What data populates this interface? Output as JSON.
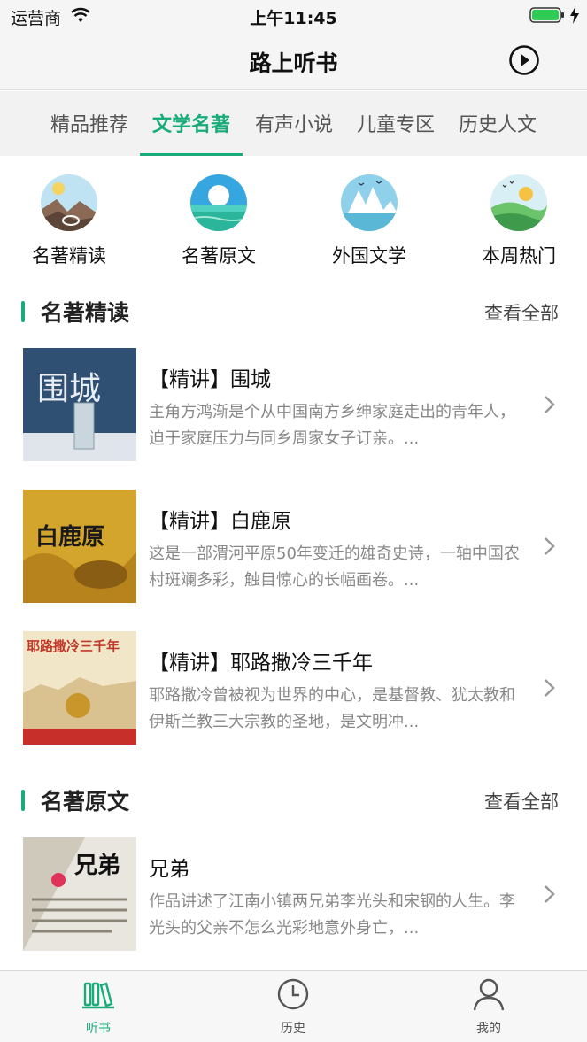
{
  "status_bar": {
    "carrier": "运营商",
    "time": "上午11:45"
  },
  "nav": {
    "title": "路上听书"
  },
  "tabs": [
    {
      "label": "精品推荐",
      "active": false
    },
    {
      "label": "文学名著",
      "active": true
    },
    {
      "label": "有声小说",
      "active": false
    },
    {
      "label": "儿童专区",
      "active": false
    },
    {
      "label": "历史人文",
      "active": false
    }
  ],
  "categories": [
    {
      "label": "名著精读"
    },
    {
      "label": "名著原文"
    },
    {
      "label": "外国文学"
    },
    {
      "label": "本周热门"
    }
  ],
  "sections": [
    {
      "title": "名著精读",
      "more": "查看全部",
      "books": [
        {
          "title": "【精讲】围城",
          "desc": "主角方鸿渐是个从中国南方乡绅家庭走出的青年人，迫于家庭压力与同乡周家女子订亲。...",
          "cover_text": "围城"
        },
        {
          "title": "【精讲】白鹿原",
          "desc": "这是一部渭河平原50年变迁的雄奇史诗，一轴中国农村斑斓多彩，触目惊心的长幅画卷。...",
          "cover_text": "白鹿原"
        },
        {
          "title": "【精讲】耶路撒冷三千年",
          "desc": "耶路撒冷曾被视为世界的中心，是基督教、犹太教和伊斯兰教三大宗教的圣地，是文明冲...",
          "cover_text": "耶路撒冷三千年"
        }
      ]
    },
    {
      "title": "名著原文",
      "more": "查看全部",
      "books": [
        {
          "title": "兄弟",
          "desc": "作品讲述了江南小镇两兄弟李光头和宋钢的人生。李光头的父亲不怎么光彩地意外身亡，...",
          "cover_text": "兄弟"
        }
      ]
    }
  ],
  "tab_bar": [
    {
      "label": "听书",
      "icon": "books-icon",
      "active": true
    },
    {
      "label": "历史",
      "icon": "clock-icon",
      "active": false
    },
    {
      "label": "我的",
      "icon": "person-icon",
      "active": false
    }
  ],
  "colors": {
    "accent": "#1aab7b",
    "background": "#ffffff",
    "bar": "#f5f5f5"
  }
}
